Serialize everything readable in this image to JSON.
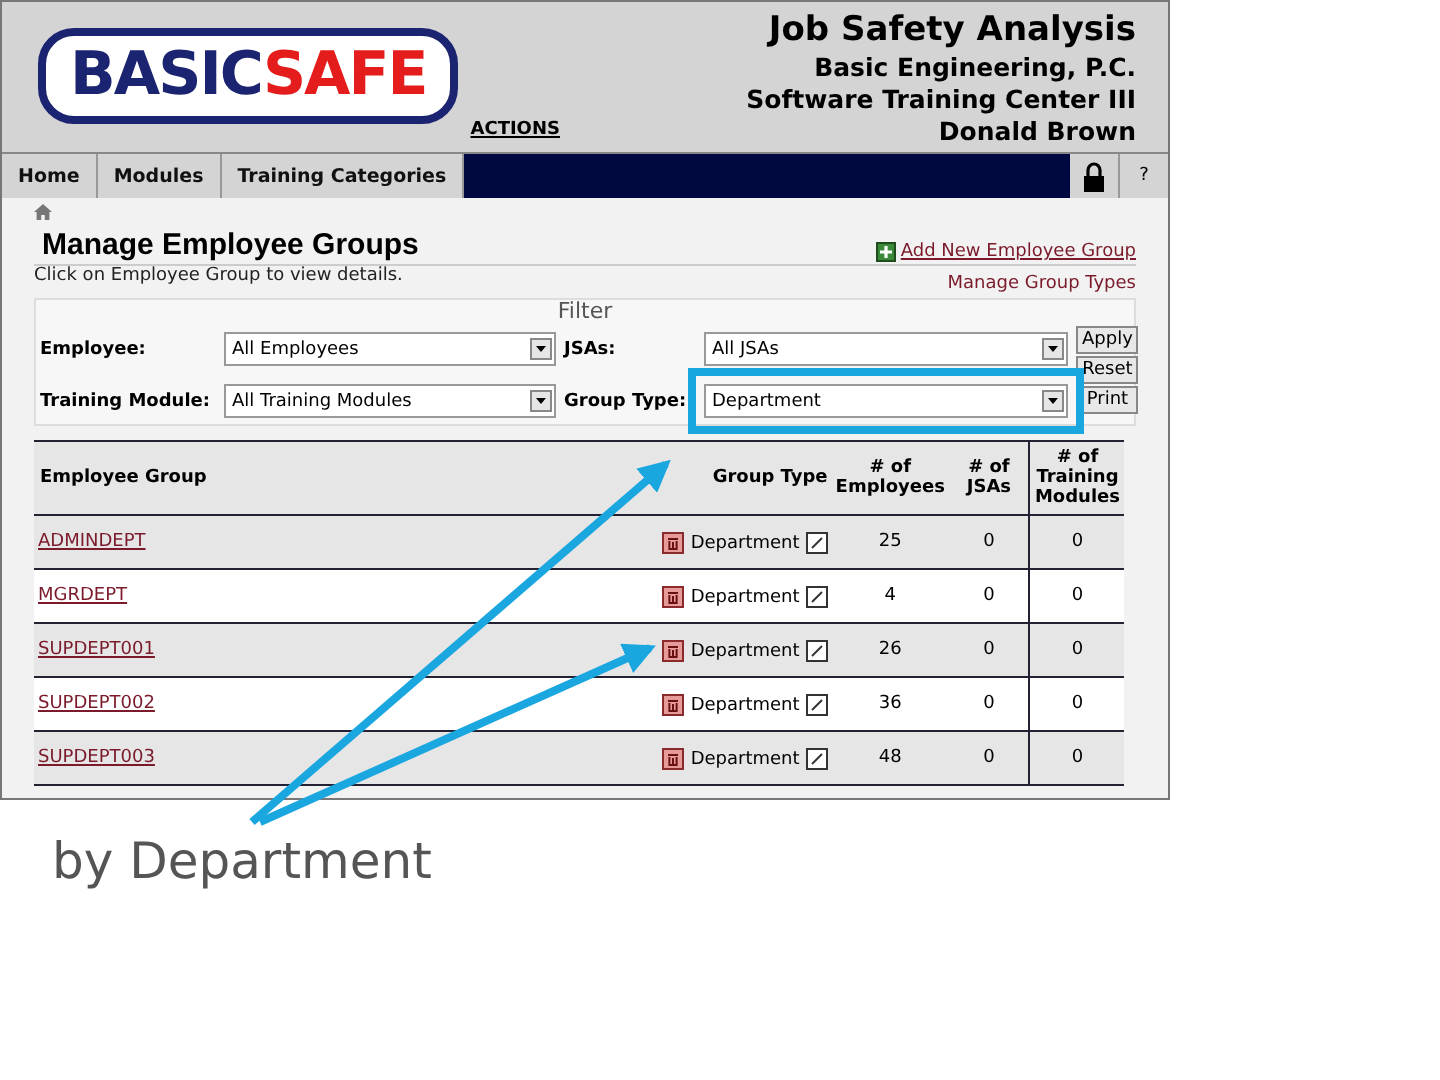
{
  "header": {
    "logo": {
      "part_1": "BASIC",
      "part_2": "SAFE"
    },
    "actions_link": "ACTIONS",
    "lines": [
      "Job Safety Analysis",
      "Basic Engineering, P.C.",
      "Software Training Center III",
      "Donald Brown"
    ]
  },
  "nav": {
    "tabs": [
      "Home",
      "Modules",
      "Training Categories"
    ],
    "help": "?"
  },
  "page": {
    "title": "Manage Employee Groups",
    "add_link": "Add New Employee Group",
    "hint": "Click on Employee Group to view details.",
    "types_link": "Manage Group Types"
  },
  "filter": {
    "legend": "Filter",
    "fields": [
      {
        "label": "Employee:",
        "value": "All Employees",
        "highlighted": false
      },
      {
        "label": "JSAs:",
        "value": "All JSAs",
        "highlighted": false
      },
      {
        "label": "Training Module:",
        "value": "All Training Modules",
        "highlighted": false
      },
      {
        "label": "Group Type:",
        "value": "Department",
        "highlighted": true
      }
    ],
    "buttons": [
      "Apply",
      "Reset",
      "Print"
    ]
  },
  "table": {
    "columns": [
      "Employee Group",
      "Group Type",
      "# of Employees",
      "# of JSAs",
      "# of Training Modules"
    ],
    "rows": [
      {
        "group": "ADMINDEPT",
        "type": "Department",
        "employees": "25",
        "jsas": "0",
        "modules": "0"
      },
      {
        "group": "MGRDEPT",
        "type": "Department",
        "employees": "4",
        "jsas": "0",
        "modules": "0"
      },
      {
        "group": "SUPDEPT001",
        "type": "Department",
        "employees": "26",
        "jsas": "0",
        "modules": "0"
      },
      {
        "group": "SUPDEPT002",
        "type": "Department",
        "employees": "36",
        "jsas": "0",
        "modules": "0"
      },
      {
        "group": "SUPDEPT003",
        "type": "Department",
        "employees": "48",
        "jsas": "0",
        "modules": "0"
      }
    ]
  },
  "caption": "by Department"
}
